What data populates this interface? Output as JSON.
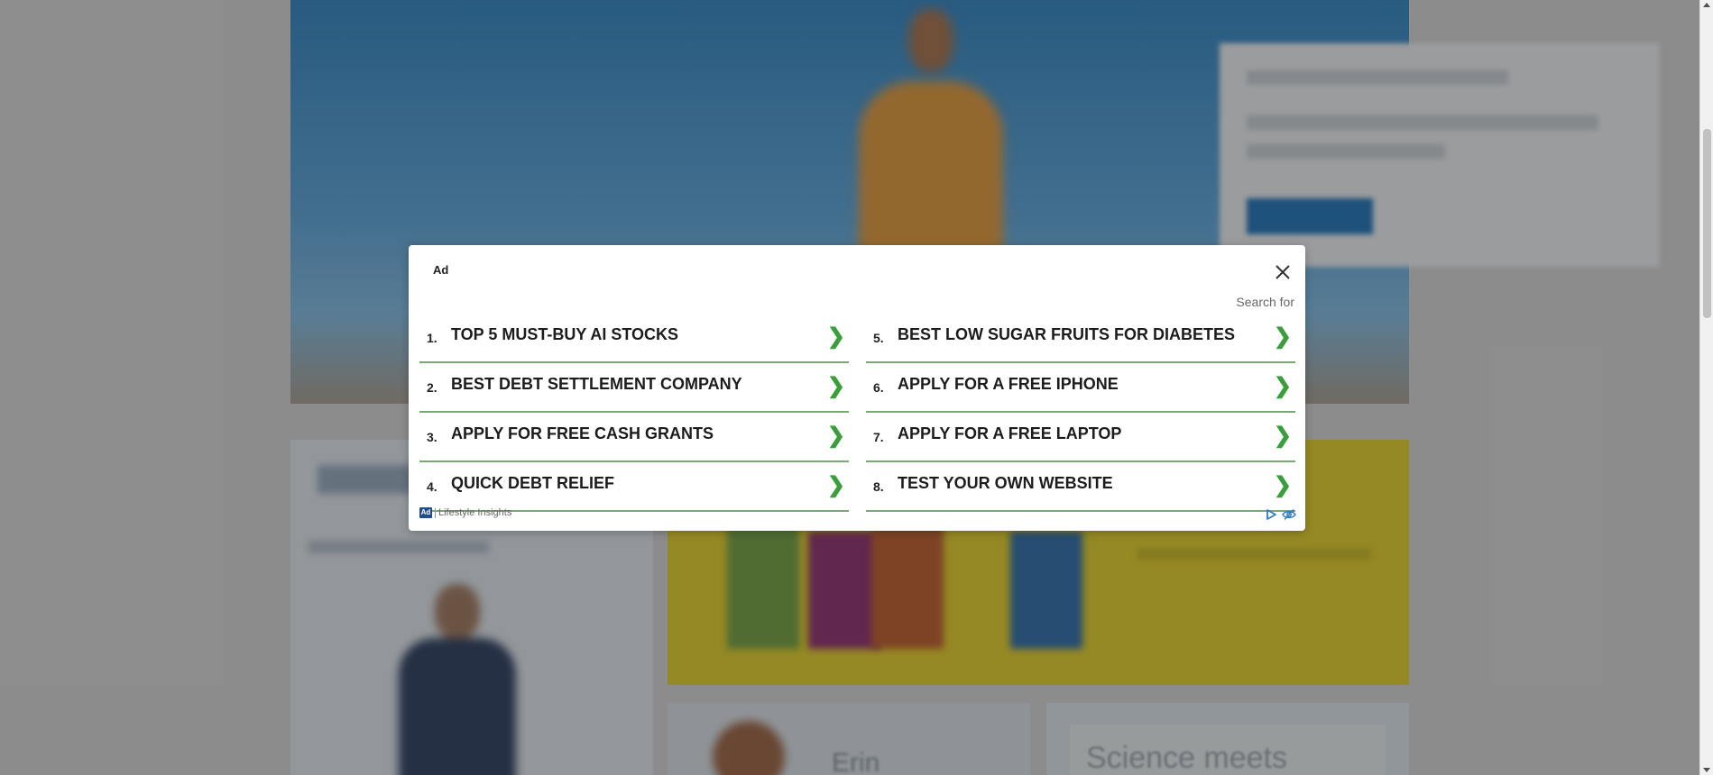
{
  "background_page": {
    "card_name_partial": "Erin",
    "card_tagline_partial": "Science meets"
  },
  "ad_modal": {
    "ad_label": "Ad",
    "search_for": "Search for",
    "left_items": [
      {
        "num": "1.",
        "label": "TOP 5 MUST-BUY AI STOCKS"
      },
      {
        "num": "2.",
        "label": "BEST DEBT SETTLEMENT COMPANY"
      },
      {
        "num": "3.",
        "label": "APPLY FOR FREE CASH GRANTS"
      },
      {
        "num": "4.",
        "label": "QUICK DEBT RELIEF"
      }
    ],
    "right_items": [
      {
        "num": "5.",
        "label": "BEST LOW SUGAR FRUITS FOR DIABETES"
      },
      {
        "num": "6.",
        "label": "APPLY FOR A FREE IPHONE"
      },
      {
        "num": "7.",
        "label": "APPLY FOR A FREE LAPTOP"
      },
      {
        "num": "8.",
        "label": "TEST YOUR OWN WEBSITE"
      }
    ],
    "chevron": "❯",
    "footer": {
      "badge": "Ad",
      "provider": "Lifestyle Insights"
    },
    "icons": [
      "close-icon",
      "adchoices-play-icon",
      "hide-eye-icon"
    ],
    "colors": {
      "divider": "#7aa874",
      "chevron": "#3a9e3a",
      "footer_icons": "#2f7fc1"
    }
  }
}
